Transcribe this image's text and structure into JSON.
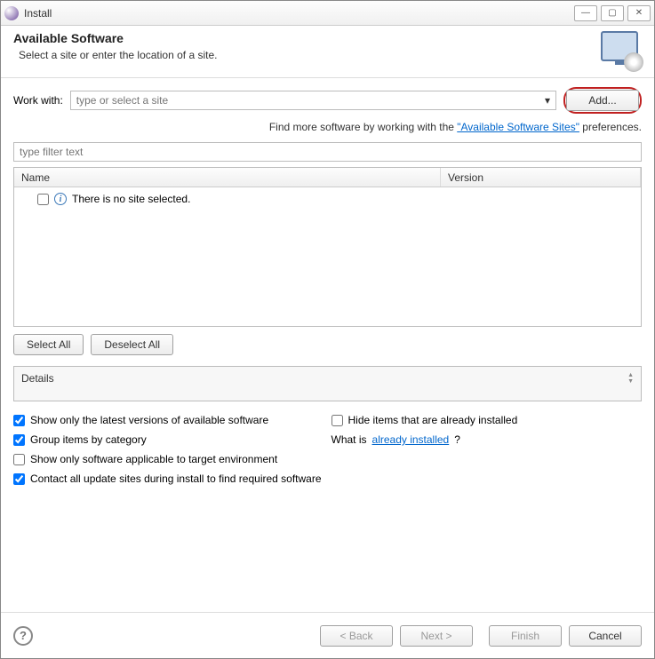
{
  "window": {
    "title": "Install"
  },
  "header": {
    "title": "Available Software",
    "subtitle": "Select a site or enter the location of a site."
  },
  "workwith": {
    "label": "Work with:",
    "placeholder": "type or select a site",
    "add_label": "Add..."
  },
  "hint": {
    "prefix": "Find more software by working with the ",
    "link": "\"Available Software Sites\"",
    "suffix": " preferences."
  },
  "filter": {
    "placeholder": "type filter text"
  },
  "table": {
    "columns": {
      "name": "Name",
      "version": "Version"
    },
    "empty_message": "There is no site selected."
  },
  "selection": {
    "select_all": "Select All",
    "deselect_all": "Deselect All"
  },
  "details": {
    "label": "Details"
  },
  "options": {
    "show_latest": {
      "label": "Show only the latest versions of available software",
      "checked": true
    },
    "hide_installed": {
      "label": "Hide items that are already installed",
      "checked": false
    },
    "group_category": {
      "label": "Group items by category",
      "checked": true
    },
    "whatis_prefix": "What is ",
    "whatis_link": "already installed",
    "whatis_suffix": "?",
    "applicable": {
      "label": "Show only software applicable to target environment",
      "checked": false
    },
    "contact_sites": {
      "label": "Contact all update sites during install to find required software",
      "checked": true
    }
  },
  "footer": {
    "back": "< Back",
    "next": "Next >",
    "finish": "Finish",
    "cancel": "Cancel"
  }
}
